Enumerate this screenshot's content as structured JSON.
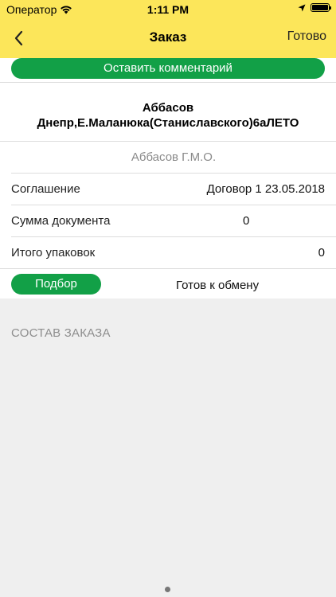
{
  "status_bar": {
    "carrier": "Оператор",
    "time": "1:11 PM"
  },
  "nav": {
    "title": "Заказ",
    "done_label": "Готово"
  },
  "comment_button": "Оставить комментарий",
  "client": {
    "name": "Аббасов",
    "address": "Днепр,Е.Маланюка(Станиславского)6аЛЕТО"
  },
  "manager": "Аббасов Г.М.О.",
  "fields": {
    "agreement_label": "Соглашение",
    "agreement_value": "Договор 1 23.05.2018",
    "sum_label": "Сумма документа",
    "sum_value": "0",
    "packages_label": "Итого упаковок",
    "packages_value": "0"
  },
  "pick_button": "Подбор",
  "exchange_status": "Готов к обмену",
  "section_header": "СОСТАВ ЗАКАЗА",
  "colors": {
    "header_bg": "#fce65a",
    "accent_green": "#12a047"
  }
}
